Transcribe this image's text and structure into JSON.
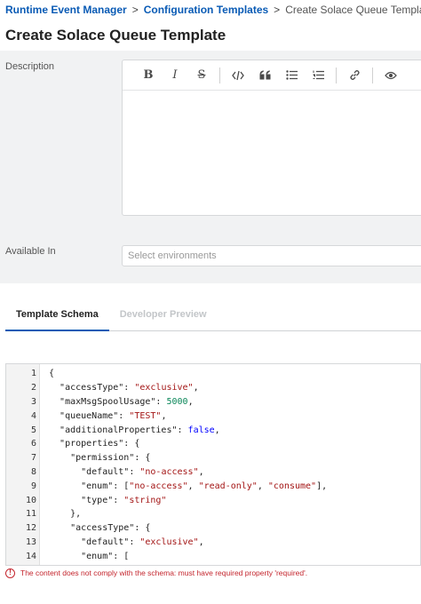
{
  "breadcrumb": {
    "items": [
      "Runtime Event Manager",
      "Configuration Templates",
      "Create Solace Queue Template"
    ],
    "separator": ">"
  },
  "page_title": "Create Solace Queue Template",
  "form": {
    "description_label": "Description",
    "toolbar_icons": [
      "bold-icon",
      "italic-icon",
      "strikethrough-icon",
      "code-icon",
      "quote-icon",
      "bullet-list-icon",
      "numbered-list-icon",
      "link-icon",
      "preview-eye-icon"
    ],
    "toolbar_glyphs": {
      "bold": "B",
      "italic": "I",
      "strike": "S"
    },
    "description_value": "",
    "available_in_label": "Available In",
    "environments_placeholder": "Select environments"
  },
  "tabs": [
    {
      "label": "Template Schema",
      "active": true
    },
    {
      "label": "Developer Preview",
      "active": false
    }
  ],
  "code_lines": [
    [
      {
        "t": "{",
        "c": "p"
      }
    ],
    [
      {
        "t": "  ",
        "c": "p"
      },
      {
        "t": "\"accessType\"",
        "c": "k"
      },
      {
        "t": ": ",
        "c": "p"
      },
      {
        "t": "\"exclusive\"",
        "c": "s"
      },
      {
        "t": ",",
        "c": "p"
      }
    ],
    [
      {
        "t": "  ",
        "c": "p"
      },
      {
        "t": "\"maxMsgSpoolUsage\"",
        "c": "k"
      },
      {
        "t": ": ",
        "c": "p"
      },
      {
        "t": "5000",
        "c": "n"
      },
      {
        "t": ",",
        "c": "p"
      }
    ],
    [
      {
        "t": "  ",
        "c": "p"
      },
      {
        "t": "\"queueName\"",
        "c": "k"
      },
      {
        "t": ": ",
        "c": "p"
      },
      {
        "t": "\"TEST\"",
        "c": "s"
      },
      {
        "t": ",",
        "c": "p"
      }
    ],
    [
      {
        "t": "  ",
        "c": "p"
      },
      {
        "t": "\"additionalProperties\"",
        "c": "k"
      },
      {
        "t": ": ",
        "c": "p"
      },
      {
        "t": "false",
        "c": "b"
      },
      {
        "t": ",",
        "c": "p"
      }
    ],
    [
      {
        "t": "  ",
        "c": "p"
      },
      {
        "t": "\"properties\"",
        "c": "k"
      },
      {
        "t": ": {",
        "c": "p"
      }
    ],
    [
      {
        "t": "    ",
        "c": "p"
      },
      {
        "t": "\"permission\"",
        "c": "k"
      },
      {
        "t": ": {",
        "c": "p"
      }
    ],
    [
      {
        "t": "      ",
        "c": "p"
      },
      {
        "t": "\"default\"",
        "c": "k"
      },
      {
        "t": ": ",
        "c": "p"
      },
      {
        "t": "\"no-access\"",
        "c": "s"
      },
      {
        "t": ",",
        "c": "p"
      }
    ],
    [
      {
        "t": "      ",
        "c": "p"
      },
      {
        "t": "\"enum\"",
        "c": "k"
      },
      {
        "t": ": [",
        "c": "p"
      },
      {
        "t": "\"no-access\"",
        "c": "s"
      },
      {
        "t": ", ",
        "c": "p"
      },
      {
        "t": "\"read-only\"",
        "c": "s"
      },
      {
        "t": ", ",
        "c": "p"
      },
      {
        "t": "\"consume\"",
        "c": "s"
      },
      {
        "t": "],",
        "c": "p"
      }
    ],
    [
      {
        "t": "      ",
        "c": "p"
      },
      {
        "t": "\"type\"",
        "c": "k"
      },
      {
        "t": ": ",
        "c": "p"
      },
      {
        "t": "\"string\"",
        "c": "s"
      }
    ],
    [
      {
        "t": "    },",
        "c": "p"
      }
    ],
    [
      {
        "t": "    ",
        "c": "p"
      },
      {
        "t": "\"accessType\"",
        "c": "k"
      },
      {
        "t": ": {",
        "c": "p"
      }
    ],
    [
      {
        "t": "      ",
        "c": "p"
      },
      {
        "t": "\"default\"",
        "c": "k"
      },
      {
        "t": ": ",
        "c": "p"
      },
      {
        "t": "\"exclusive\"",
        "c": "s"
      },
      {
        "t": ",",
        "c": "p"
      }
    ],
    [
      {
        "t": "      ",
        "c": "p"
      },
      {
        "t": "\"enum\"",
        "c": "k"
      },
      {
        "t": ": [",
        "c": "p"
      }
    ]
  ],
  "error": {
    "icon": "error-circle-icon",
    "icon_glyph": "!",
    "message": "The content does not comply with the schema: must have required property 'required'."
  },
  "colors": {
    "link": "#0a5bb5",
    "error": "#c4262e",
    "panel_bg": "#f1f2f3",
    "string": "#a31515",
    "number": "#098658",
    "boolean": "#0000ff"
  }
}
